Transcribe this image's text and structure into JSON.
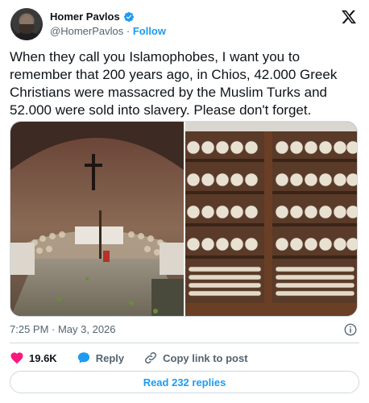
{
  "author": {
    "name": "Homer Pavlos",
    "handle": "@HomerPavlos",
    "separator": "·",
    "follow_label": "Follow"
  },
  "tweet": {
    "text": "When they call you Islamophobes, I want you to remember that 200 years ago, in Chios, 42.000 Greek Christians were massacred by the Muslim Turks and 52.000 were sold into slavery. Please don't forget.",
    "timestamp": "7:25 PM · May 3, 2026"
  },
  "media": [
    {
      "icon": "ossuary-chapel-photo"
    },
    {
      "icon": "skull-cabinet-photo"
    }
  ],
  "actions": {
    "like_count": "19.6K",
    "reply_label": "Reply",
    "copy_link_label": "Copy link to post"
  },
  "read_replies_label": "Read 232 replies",
  "colors": {
    "accent": "#1d9bf0",
    "like": "#f91880",
    "muted": "#536471",
    "border": "#cfd9de"
  }
}
